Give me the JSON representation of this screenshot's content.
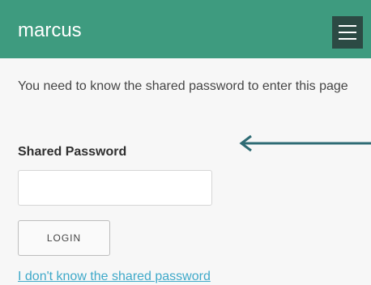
{
  "header": {
    "brand": "marcus",
    "menu_icon": "hamburger-menu-icon",
    "background": "#3e9b7f"
  },
  "main": {
    "intro": "You need to know the shared password to enter this page",
    "password_label": "Shared Password",
    "password_value": "",
    "password_placeholder": "",
    "login_label": "LOGIN",
    "forgot_link": "I don't know the shared password"
  },
  "annotation": {
    "icon": "left-arrow-icon",
    "color": "#2e6b74"
  }
}
